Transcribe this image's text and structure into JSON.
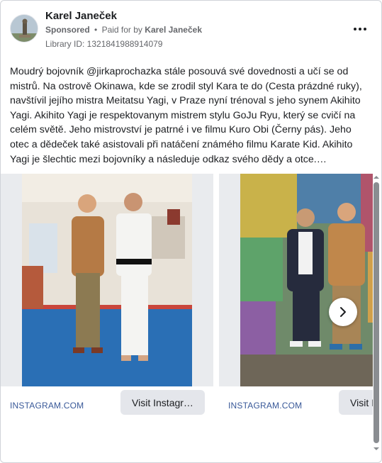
{
  "header": {
    "page_name": "Karel Janeček",
    "sponsored_label": "Sponsored",
    "separator": "•",
    "paid_for_prefix": "Paid for by",
    "paid_for_name": "Karel Janeček",
    "library_id": "Library ID: 1321841988914079",
    "more_icon": "more-horizontal-icon"
  },
  "body_text": "Moudrý bojovník @jirkaprochazka stále posouvá své dovednosti a učí se od mistrů. Na ostrově Okinawa, kde se zrodil styl Kara te do (Cesta prázdné ruky), navštívil jejího mistra Meitatsu Yagi, v Praze nyní trénoval s jeho synem Akihito Yagi. Akihito Yagi je respektovanym mistrem stylu GoJu Ryu, který se cvičí na celém světě. Jeho mistrovství je patrné i ve filmu Kuro Obi (Černy pás). Jeho otec a dědeček také asistovali při natáčení známého filmu Karate Kid. Akihito Yagi je šlechtic mezi bojovníky a následuje odkaz svého dědy a otce.…",
  "carousel": {
    "items": [
      {
        "domain": "INSTAGRAM.COM",
        "button": "Visit Instagr…"
      },
      {
        "domain": "INSTAGRAM.COM",
        "button": "Visit Instagr…"
      }
    ],
    "next_icon": "chevron-right-icon"
  },
  "colors": {
    "text": "#1c1e21",
    "secondary": "#65676b",
    "link": "#385898",
    "button_bg": "#e4e6eb"
  }
}
